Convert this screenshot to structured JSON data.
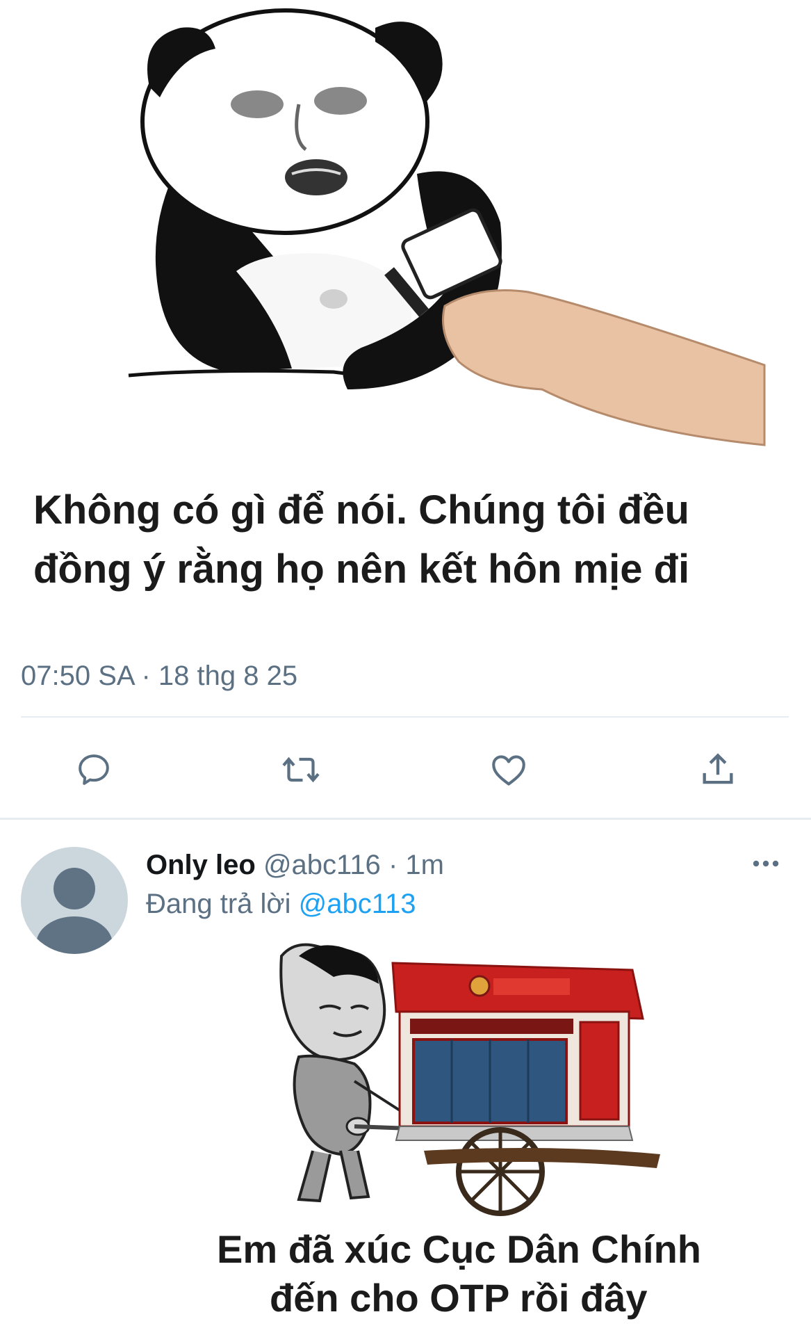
{
  "tweet": {
    "image_caption_line1": "Không có gì để nói. Chúng tôi đều",
    "image_caption_line2": "đồng ý rằng họ nên kết hôn mịe đi",
    "meta": "07:50 SA · 18 thg 8 25",
    "actions": [
      "reply-icon",
      "retweet-icon",
      "like-icon",
      "share-icon"
    ]
  },
  "reply": {
    "name": "Only leo",
    "handle": "@abc116",
    "separator": "·",
    "time": "1m",
    "replying_prefix": "Đang trả lời",
    "replying_to": "@abc113",
    "more_icon": "more-icon",
    "image_caption_line1": "Em đã xúc Cục Dân Chính",
    "image_caption_line2": "đến cho OTP rồi đây"
  },
  "colors": {
    "secondary_text": "#5b7083",
    "link": "#1da1f2",
    "divider": "#e6ecf0",
    "booth_red": "#c8201e"
  }
}
